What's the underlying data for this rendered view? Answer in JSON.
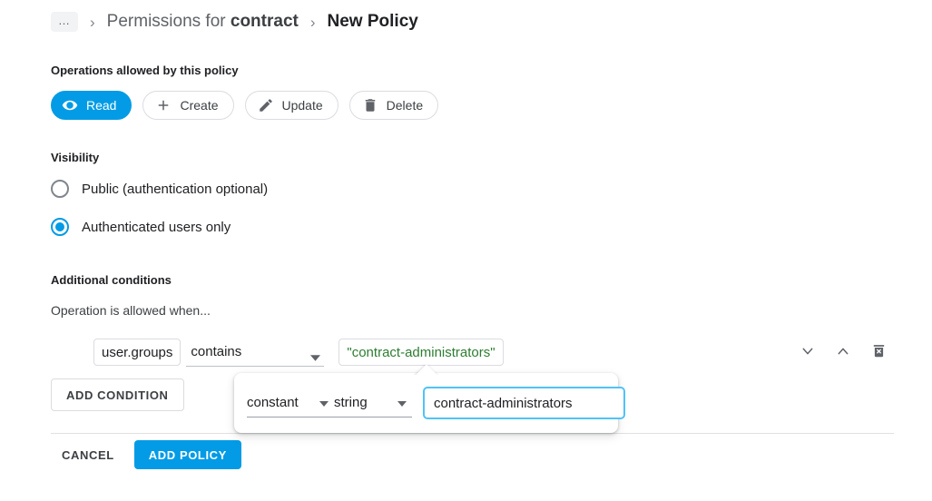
{
  "breadcrumb": {
    "ellipsis": "…",
    "separator": "›",
    "parent_prefix": "Permissions for ",
    "parent_target": "contract",
    "current": "New Policy"
  },
  "operations": {
    "label": "Operations allowed by this policy",
    "items": [
      {
        "label": "Read",
        "icon": "eye-icon",
        "selected": true
      },
      {
        "label": "Create",
        "icon": "plus-icon",
        "selected": false
      },
      {
        "label": "Update",
        "icon": "pencil-icon",
        "selected": false
      },
      {
        "label": "Delete",
        "icon": "trash-icon",
        "selected": false
      }
    ]
  },
  "visibility": {
    "label": "Visibility",
    "options": [
      {
        "label": "Public (authentication optional)",
        "checked": false
      },
      {
        "label": "Authenticated users only",
        "checked": true
      }
    ]
  },
  "conditions": {
    "label": "Additional conditions",
    "hint": "Operation is allowed when...",
    "row": {
      "field": "user.groups",
      "operator": "contains",
      "value_display": "\"contract-administrators\"",
      "actions": {
        "move_down": "chevron-down-icon",
        "move_up": "chevron-up-icon",
        "delete": "delete-condition-icon"
      }
    },
    "editor": {
      "kind": "constant",
      "type": "string",
      "value": "contract-administrators",
      "placeholder": ""
    },
    "add_button": "ADD CONDITION"
  },
  "footer": {
    "cancel": "CANCEL",
    "submit": "ADD POLICY"
  },
  "colors": {
    "accent": "#039be5",
    "focus_border": "#4fc3f7",
    "value_green": "#2e7d32",
    "icon_gray": "#5f6368",
    "border_gray": "#dadce0"
  }
}
